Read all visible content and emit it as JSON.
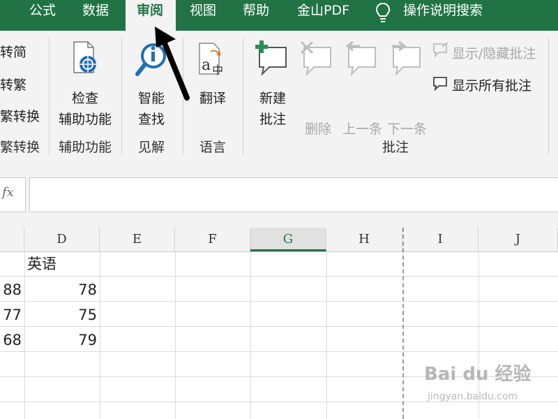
{
  "ribbon_tabs": {
    "formulas": "公式",
    "data": "数据",
    "review": "审阅",
    "view": "视图",
    "help": "帮助",
    "pdf": "金山PDF",
    "search": "操作说明搜索"
  },
  "chinese_group": {
    "trad_to_simp": "转简",
    "simp_to_trad": "转繁",
    "convert": "繁转换",
    "label": "繁转换"
  },
  "accessibility_group": {
    "check_line1": "检查",
    "check_line2": "辅助功能",
    "label": "辅助功能"
  },
  "insights_group": {
    "smart_line1": "智能",
    "smart_line2": "查找",
    "label": "见解"
  },
  "language_group": {
    "translate": "翻译",
    "label": "语言"
  },
  "comments_group": {
    "new_line1": "新建",
    "new_line2": "批注",
    "delete": "删除",
    "previous": "上一条",
    "next": "下一条",
    "show_hide": "显示/隐藏批注",
    "show_all": "显示所有批注",
    "label": "批注"
  },
  "formula_bar": {
    "fx": "fx",
    "value": ""
  },
  "columns": [
    "D",
    "E",
    "F",
    "G",
    "H",
    "I",
    "J"
  ],
  "selected_column": "G",
  "cells": {
    "d1": "英语",
    "c2": "88",
    "d2": "78",
    "c3": "77",
    "d3": "75",
    "c4": "68",
    "d4": "79"
  },
  "watermark": {
    "brand": "Bai du 经验",
    "url": "jingyan.baidu.com"
  },
  "colors": {
    "tab_bar": "#217346",
    "ribbon_bg": "#f3f3f3",
    "accent_green": "#2e8b57",
    "icon_blue": "#1f6fb5",
    "disabled": "#a8a8a8"
  }
}
